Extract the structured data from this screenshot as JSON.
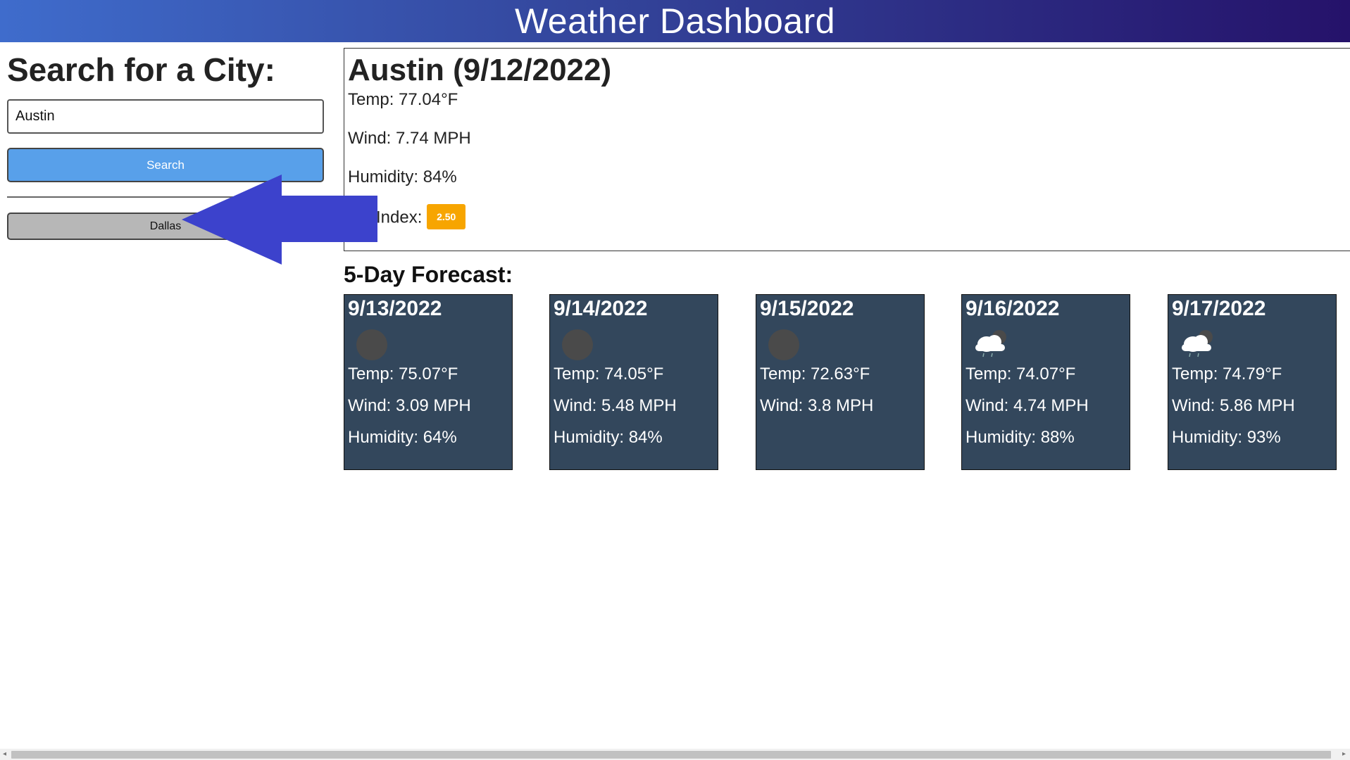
{
  "header": {
    "title": "Weather Dashboard"
  },
  "sidebar": {
    "heading": "Search for a City:",
    "search_value": "Austin",
    "search_button": "Search",
    "history": [
      "Dallas"
    ]
  },
  "current": {
    "title": "Austin (9/12/2022)",
    "temp": "Temp: 77.04°F",
    "wind": "Wind: 7.74 MPH",
    "humidity": "Humidity: 84%",
    "uv_label": "UV Index:",
    "uv_value": "2.50"
  },
  "forecast": {
    "title": "5-Day Forecast:",
    "days": [
      {
        "date": "9/13/2022",
        "icon": "moon-icon",
        "temp": "Temp: 75.07°F",
        "wind": "Wind: 3.09 MPH",
        "humidity": "Humidity: 64%"
      },
      {
        "date": "9/14/2022",
        "icon": "moon-icon",
        "temp": "Temp: 74.05°F",
        "wind": "Wind: 5.48 MPH",
        "humidity": "Humidity: 84%"
      },
      {
        "date": "9/15/2022",
        "icon": "moon-icon",
        "temp": "Temp: 72.63°F",
        "wind": "Wind: 3.8 MPH",
        "humidity": ""
      },
      {
        "date": "9/16/2022",
        "icon": "cloud-rain-icon",
        "temp": "Temp: 74.07°F",
        "wind": "Wind: 4.74 MPH",
        "humidity": "Humidity: 88%"
      },
      {
        "date": "9/17/2022",
        "icon": "cloud-rain-icon",
        "temp": "Temp: 74.79°F",
        "wind": "Wind: 5.86 MPH",
        "humidity": "Humidity: 93%"
      }
    ]
  },
  "colors": {
    "header_gradient_start": "#3f6ccc",
    "header_gradient_end": "#25126a",
    "search_button": "#58a0ea",
    "card_bg": "#33475c",
    "uv_badge": "#f7a500",
    "annotation_arrow": "#3c42cc"
  }
}
